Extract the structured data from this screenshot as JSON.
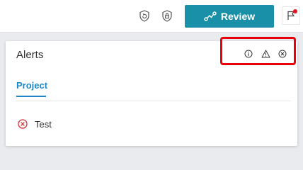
{
  "header": {
    "review_label": "Review",
    "accent": "#1a8fa8",
    "icons": [
      "shield-refresh-icon",
      "shield-lock-icon",
      "flag-icon"
    ],
    "flag_has_notification": true
  },
  "alerts_panel": {
    "title": "Alerts",
    "header_icons": [
      "info-icon",
      "warning-icon",
      "error-icon"
    ],
    "highlight_color": "#e8000b",
    "tabs": [
      {
        "label": "Project",
        "active": true
      }
    ],
    "items": [
      {
        "label": "Test",
        "status": "error",
        "icon": "error-circle-icon"
      }
    ]
  }
}
